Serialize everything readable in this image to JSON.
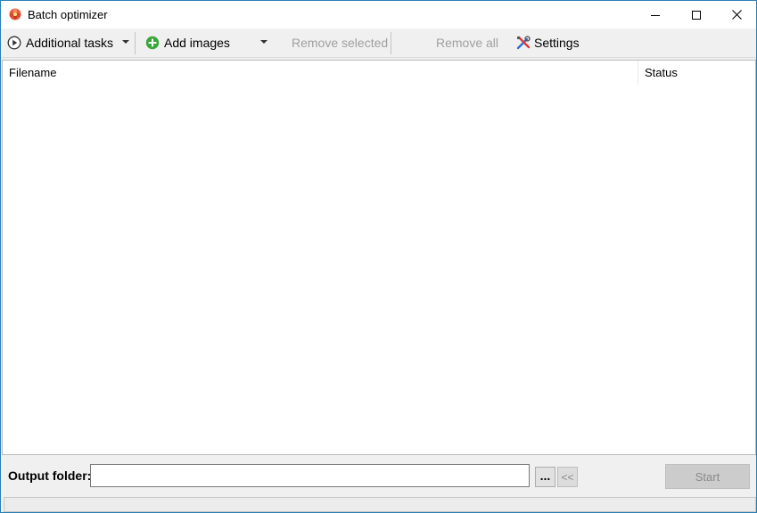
{
  "window": {
    "title": "Batch optimizer"
  },
  "toolbar": {
    "additional_tasks": "Additional tasks",
    "add_images": "Add images",
    "remove_selected": "Remove selected",
    "remove_all": "Remove all",
    "settings": "Settings"
  },
  "list": {
    "columns": [
      "Filename",
      "Status"
    ],
    "rows": []
  },
  "output": {
    "label": "Output folder:",
    "value": "",
    "browse_label": "...",
    "back_label": "<<",
    "start_label": "Start"
  },
  "colors": {
    "accent_border": "#2b7fb3",
    "add_icon": "#3aa63a",
    "disabled_text": "#a0a0a0"
  },
  "icons": {
    "app": "app-flower-icon",
    "additional_tasks": "play-circle-icon",
    "add_images": "plus-circle-icon",
    "settings": "tools-icon"
  }
}
